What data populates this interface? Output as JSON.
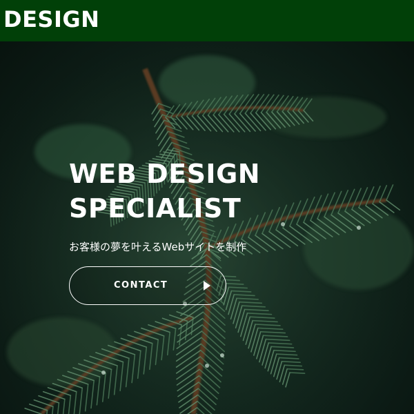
{
  "header": {
    "logo_text": "DESIGN",
    "background_color": "#014008"
  },
  "hero": {
    "title_line1": "WEB DESIGN",
    "title_line2": "SPECIALIST",
    "subtitle": "お客様の夢を叶えるWebサイトを制作",
    "background_image": "pine-branch-photo",
    "cta": {
      "label": "CONTACT",
      "icon": "play-triangle-icon"
    }
  }
}
